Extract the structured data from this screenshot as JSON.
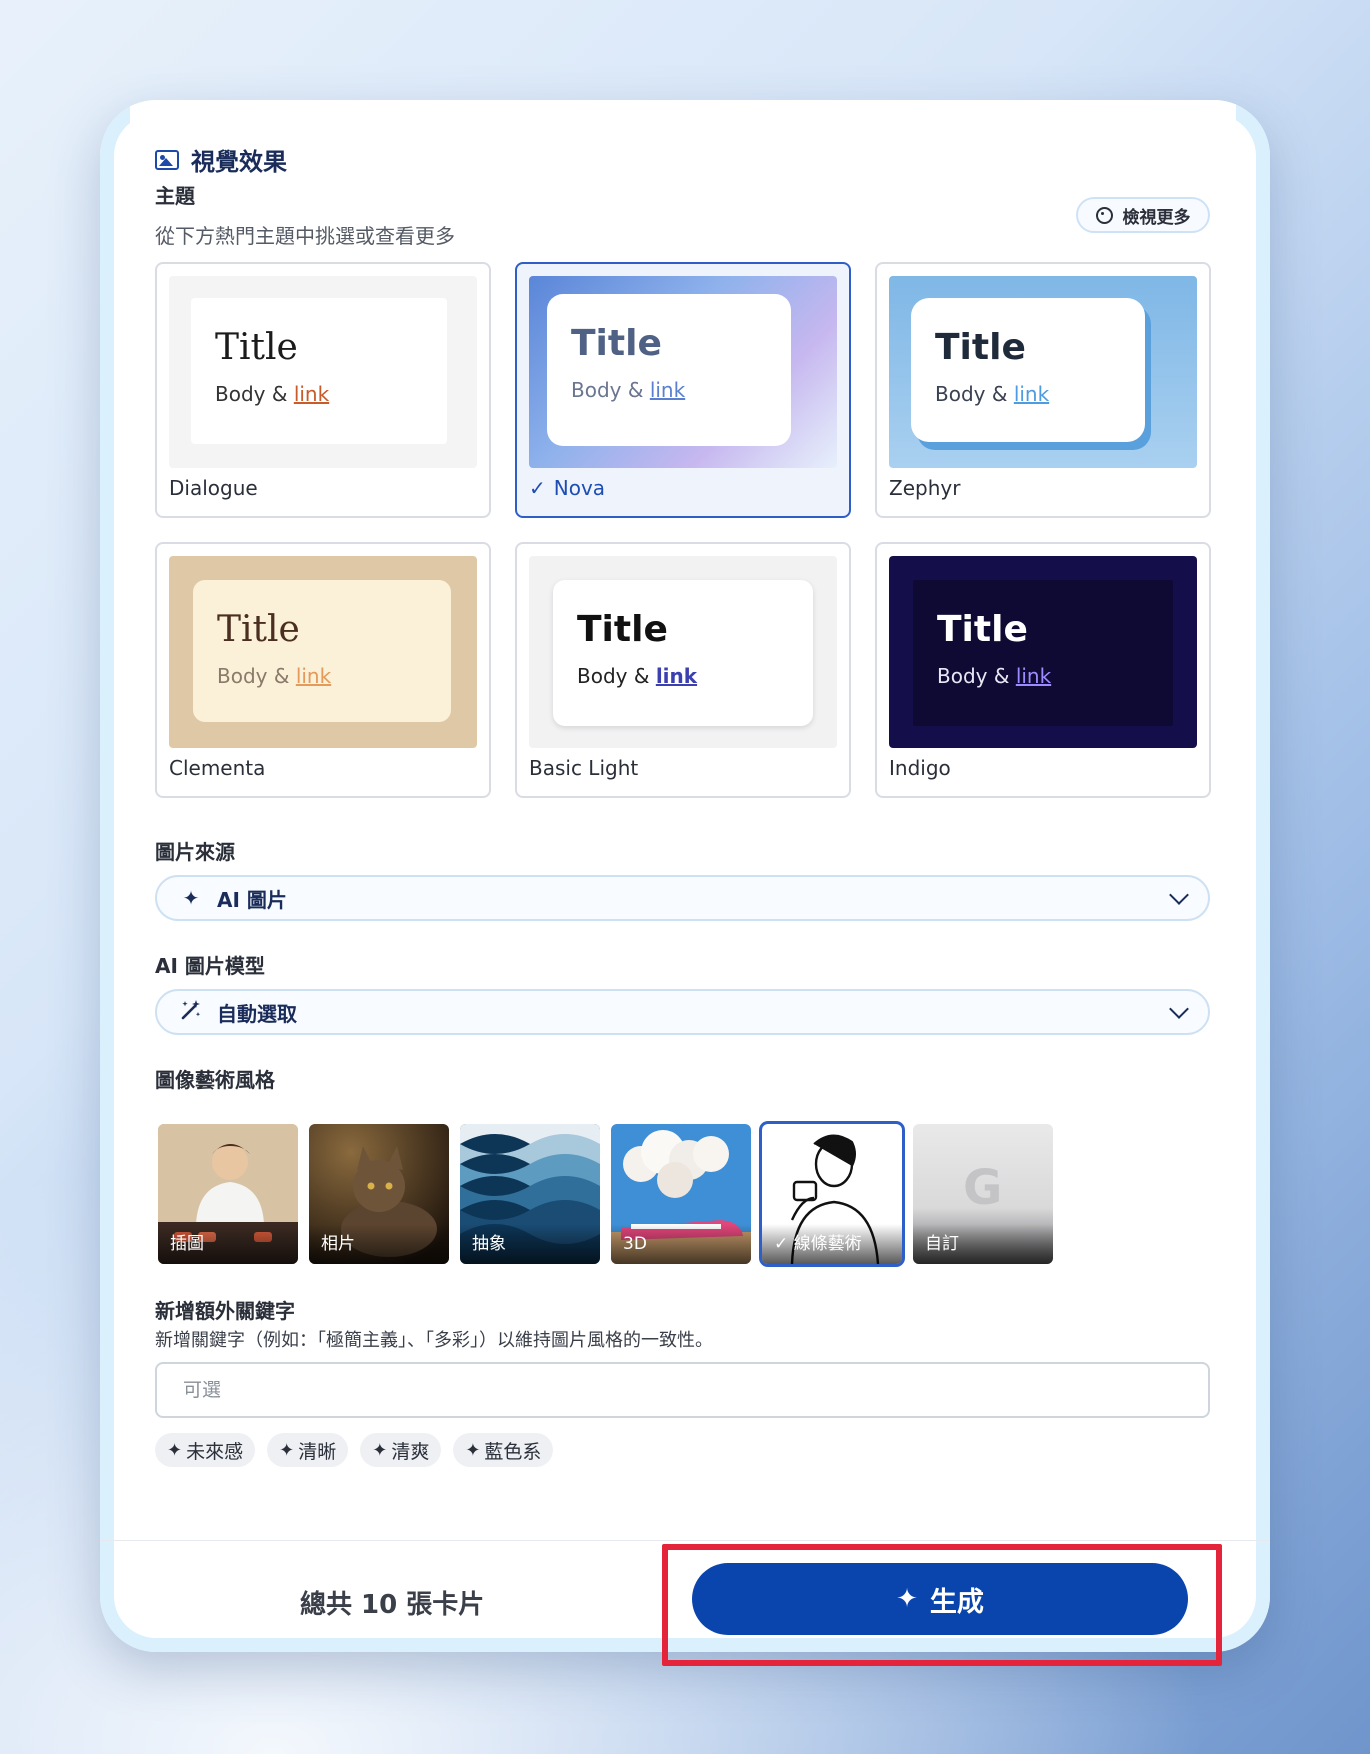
{
  "section": {
    "title": "視覺效果"
  },
  "theme": {
    "label": "主題",
    "subtitle": "從下方熱門主題中挑選或查看更多",
    "view_more": "檢視更多",
    "cards": [
      {
        "name": "Dialogue",
        "title": "Title",
        "body": "Body & ",
        "link": "link",
        "selected": false
      },
      {
        "name": "Nova",
        "title": "Title",
        "body": "Body & ",
        "link": "link",
        "selected": true
      },
      {
        "name": "Zephyr",
        "title": "Title",
        "body": "Body & ",
        "link": "link",
        "selected": false
      },
      {
        "name": "Clementa",
        "title": "Title",
        "body": "Body & ",
        "link": "link",
        "selected": false
      },
      {
        "name": "Basic Light",
        "title": "Title",
        "body": "Body & ",
        "link": "link",
        "selected": false
      },
      {
        "name": "Indigo",
        "title": "Title",
        "body": "Body & ",
        "link": "link",
        "selected": false
      }
    ]
  },
  "image_source": {
    "label": "圖片來源",
    "value": "AI 圖片",
    "icon": "sparkle-icon"
  },
  "image_model": {
    "label": "AI 圖片模型",
    "value": "自動選取",
    "icon": "magic-wand-icon"
  },
  "art_style": {
    "label": "圖像藝術風格",
    "tiles": [
      {
        "caption": "插圖",
        "selected": false
      },
      {
        "caption": "相片",
        "selected": false
      },
      {
        "caption": "抽象",
        "selected": false
      },
      {
        "caption": "3D",
        "selected": false
      },
      {
        "caption": "✓ 線條藝術",
        "selected": true
      },
      {
        "caption": "自訂",
        "selected": false
      }
    ]
  },
  "keywords": {
    "label": "新增額外關鍵字",
    "hint": "新增關鍵字（例如：「極簡主義」、「多彩」）以維持圖片風格的一致性。",
    "placeholder": "可選",
    "chips": [
      "未來感",
      "清晰",
      "清爽",
      "藍色系"
    ]
  },
  "footer": {
    "total": "總共 10 張卡片",
    "generate": "生成"
  },
  "colors": {
    "accent": "#0a44ad",
    "selected_border": "#2e5fc9",
    "highlight": "#e3243b"
  }
}
